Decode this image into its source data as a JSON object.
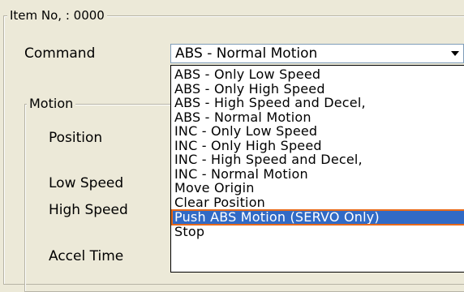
{
  "item_group": {
    "title": "Item No, : 0000"
  },
  "command": {
    "label": "Command",
    "value": "ABS - Normal Motion"
  },
  "motion_group": {
    "title": "Motion",
    "fields": [
      "Position",
      "Low Speed",
      "High Speed",
      "Accel Time"
    ]
  },
  "dropdown": {
    "options": [
      "ABS - Only Low Speed",
      "ABS - Only High Speed",
      "ABS - High Speed and Decel,",
      "ABS - Normal Motion",
      "INC - Only Low Speed",
      "INC - Only High Speed",
      "INC - High Speed and Decel,",
      "INC - Normal Motion",
      "Move Origin",
      "Clear Position",
      "Push ABS Motion (SERVO Only)",
      "Stop"
    ],
    "selected_index": 10
  },
  "colors": {
    "selection": "#316ac5",
    "highlight_outline": "#e86a1a",
    "window_bg": "#ece9d8"
  },
  "icons": {
    "combo_arrow": "chevron-down-icon"
  }
}
